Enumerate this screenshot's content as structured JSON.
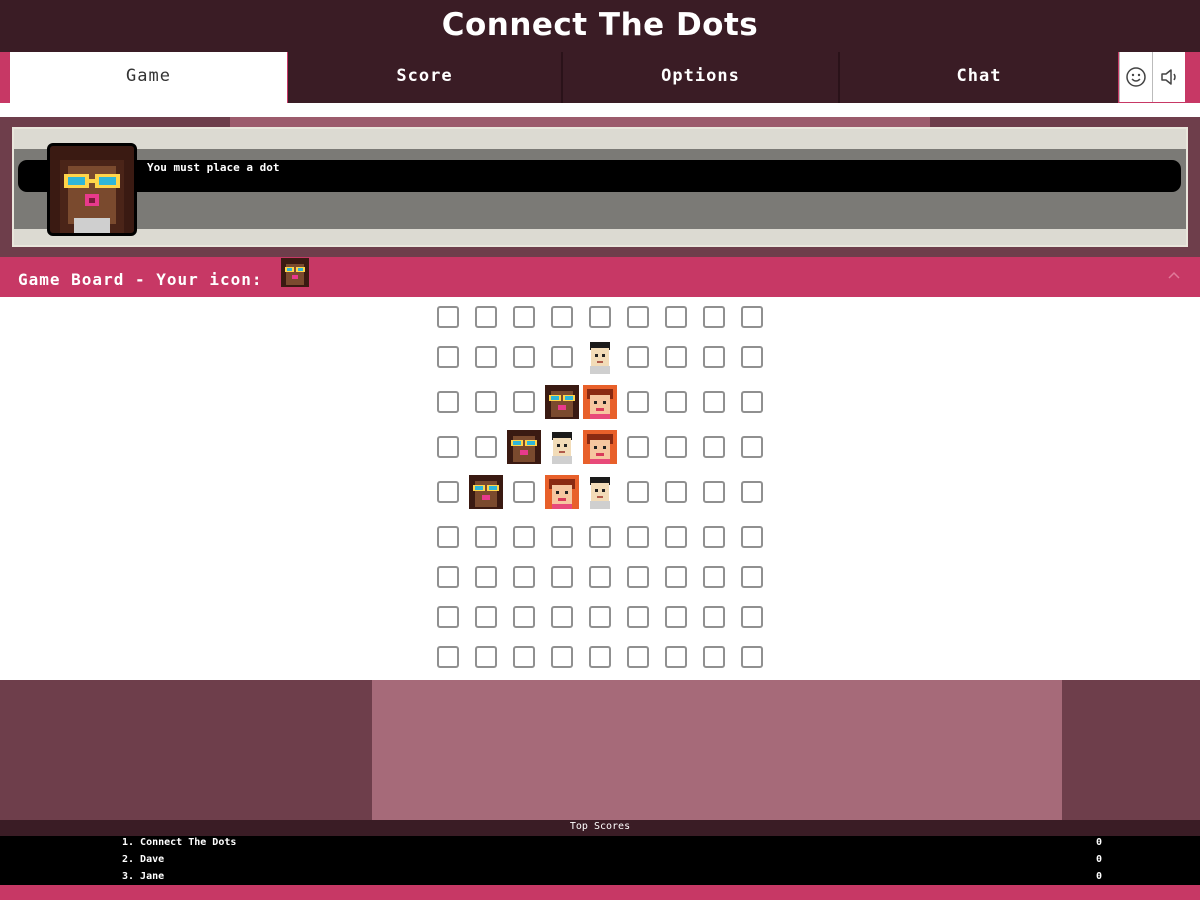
{
  "header": {
    "title": "Connect The Dots"
  },
  "tabs": [
    {
      "label": "Game",
      "active": true
    },
    {
      "label": "Score",
      "active": false
    },
    {
      "label": "Options",
      "active": false
    },
    {
      "label": "Chat",
      "active": false
    }
  ],
  "toolbar_icons": [
    "smiley-icon",
    "speaker-icon"
  ],
  "message": {
    "text": "You must place a dot"
  },
  "board": {
    "title": "Game Board - Your icon:",
    "rows": 9,
    "cols": 9,
    "pieces": [
      {
        "row": 1,
        "col": 4,
        "player": "boy"
      },
      {
        "row": 2,
        "col": 3,
        "player": "you"
      },
      {
        "row": 2,
        "col": 4,
        "player": "girl"
      },
      {
        "row": 3,
        "col": 2,
        "player": "you"
      },
      {
        "row": 3,
        "col": 3,
        "player": "boy"
      },
      {
        "row": 3,
        "col": 4,
        "player": "girl"
      },
      {
        "row": 4,
        "col": 1,
        "player": "you"
      },
      {
        "row": 4,
        "col": 3,
        "player": "girl"
      },
      {
        "row": 4,
        "col": 4,
        "player": "boy"
      }
    ]
  },
  "top_scores": {
    "title": "Top Scores",
    "entries": [
      {
        "name": "1. Connect The Dots",
        "score": "0"
      },
      {
        "name": "2. Dave",
        "score": "0"
      },
      {
        "name": "3. Jane",
        "score": "0"
      }
    ]
  },
  "colors": {
    "accent": "#c73865",
    "dark": "#3a1c25",
    "band": "#6e3e4b",
    "band_light": "#a66a79"
  }
}
